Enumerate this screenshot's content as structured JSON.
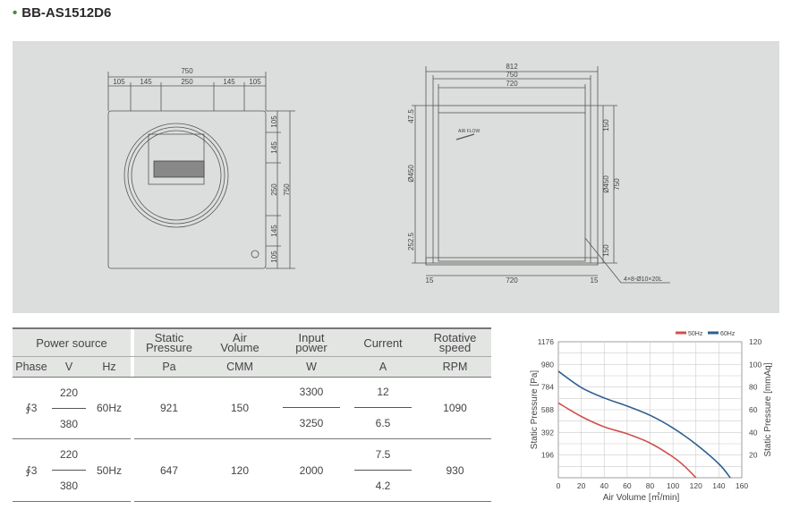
{
  "title": "BB-AS1512D6",
  "drawing_front": {
    "top_dims": [
      "105",
      "145",
      "250",
      "145",
      "105"
    ],
    "overall_width": "750",
    "side_dims": [
      "105",
      "145",
      "250",
      "145",
      "105"
    ],
    "overall_height": "750"
  },
  "drawing_side": {
    "top_dims": [
      "812",
      "750",
      "720"
    ],
    "left_dims": [
      "47.5",
      "Ø450",
      "252.5"
    ],
    "right_dims": [
      "150",
      "Ø450",
      "750",
      "150"
    ],
    "bottom_dims": [
      "15",
      "720",
      "15"
    ],
    "airflow_label": "AIR FLOW",
    "hole_callout": "4×8-Ø10×20L"
  },
  "table": {
    "headers": {
      "power_source": "Power source",
      "static_pressure": "Static\nPressure",
      "air_volume": "Air\nVolume",
      "input_power": "Input\npower",
      "current": "Current",
      "rotative_speed": "Rotative\nspeed"
    },
    "units": {
      "phase": "Phase",
      "v": "V",
      "hz": "Hz",
      "pa": "Pa",
      "cmm": "CMM",
      "w": "W",
      "a": "A",
      "rpm": "RPM"
    },
    "rows": [
      {
        "phase": "∮3",
        "v_top": "220",
        "v_bottom": "380",
        "hz": "60Hz",
        "pa": "921",
        "cmm": "150",
        "w_top": "3300",
        "w_bottom": "3250",
        "a_top": "12",
        "a_bottom": "6.5",
        "rpm": "1090"
      },
      {
        "phase": "∮3",
        "v_top": "220",
        "v_bottom": "380",
        "hz": "50Hz",
        "pa": "647",
        "cmm": "120",
        "w": "2000",
        "a_top": "7.5",
        "a_bottom": "4.2",
        "rpm": "930"
      }
    ]
  },
  "chart_data": {
    "type": "line",
    "xlabel": "Air Volume [㎥/min]",
    "ylabel": "Static Pressure [Pa]",
    "y2label": "Static Pressure [mmAq]",
    "xlim": [
      0,
      160
    ],
    "ylim": [
      0,
      1176
    ],
    "y2lim": [
      0,
      120
    ],
    "x_ticks": [
      "0",
      "20",
      "40",
      "60",
      "80",
      "100",
      "120",
      "140",
      "160"
    ],
    "y_ticks": [
      "196",
      "392",
      "588",
      "784",
      "980",
      "1176"
    ],
    "y2_ticks": [
      "20",
      "40",
      "60",
      "80",
      "100",
      "120"
    ],
    "legend_position": "top-right",
    "grid": true,
    "series": [
      {
        "name": "50Hz",
        "color": "#d0504c",
        "x": [
          0,
          20,
          40,
          60,
          80,
          100,
          110,
          120
        ],
        "y": [
          647,
          530,
          440,
          380,
          300,
          180,
          100,
          0
        ]
      },
      {
        "name": "60Hz",
        "color": "#2f5f8f",
        "x": [
          0,
          20,
          40,
          60,
          80,
          100,
          120,
          140,
          150
        ],
        "y": [
          921,
          780,
          690,
          620,
          540,
          430,
          290,
          120,
          0
        ]
      }
    ]
  }
}
